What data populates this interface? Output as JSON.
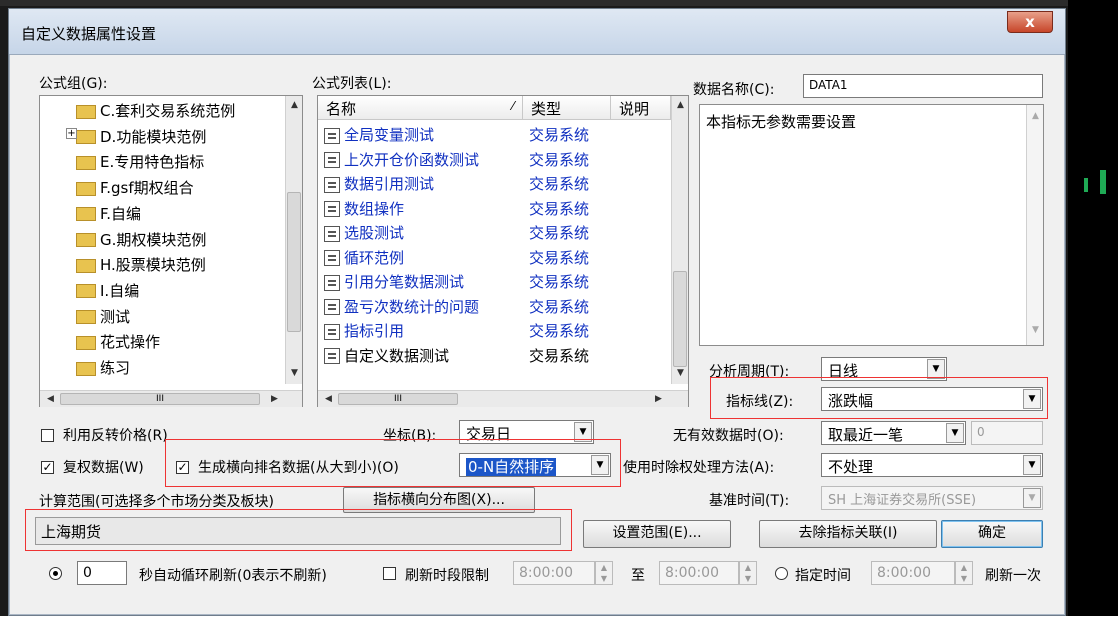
{
  "window": {
    "title": "自定义数据属性设置",
    "close_label": "x"
  },
  "formula_group": {
    "label": "公式组(G):",
    "items": [
      {
        "label": "C.套利交易系统范例",
        "expand": ""
      },
      {
        "label": "D.功能模块范例",
        "expand": "+"
      },
      {
        "label": "E.专用特色指标",
        "expand": ""
      },
      {
        "label": "F.gsf期权组合",
        "expand": ""
      },
      {
        "label": "F.自编",
        "expand": ""
      },
      {
        "label": "G.期权模块范例",
        "expand": ""
      },
      {
        "label": "H.股票模块范例",
        "expand": ""
      },
      {
        "label": "I.自编",
        "expand": ""
      },
      {
        "label": "测试",
        "expand": ""
      },
      {
        "label": "花式操作",
        "expand": ""
      },
      {
        "label": "练习",
        "expand": ""
      }
    ],
    "hscroll_grip": "III"
  },
  "formula_list": {
    "label": "公式列表(L):",
    "columns": {
      "name": "名称",
      "type": "类型",
      "desc": "说明"
    },
    "rows": [
      {
        "name": "全局变量测试",
        "type": "交易系统"
      },
      {
        "name": "上次开仓价函数测试",
        "type": "交易系统"
      },
      {
        "name": "数据引用测试",
        "type": "交易系统"
      },
      {
        "name": "数组操作",
        "type": "交易系统"
      },
      {
        "name": "选股测试",
        "type": "交易系统"
      },
      {
        "name": "循环范例",
        "type": "交易系统"
      },
      {
        "name": "引用分笔数据测试",
        "type": "交易系统"
      },
      {
        "name": "盈亏次数统计的问题",
        "type": "交易系统"
      },
      {
        "name": "指标引用",
        "type": "交易系统"
      },
      {
        "name": "自定义数据测试",
        "type": "交易系统"
      }
    ],
    "hscroll_grip": "III"
  },
  "data_name": {
    "label": "数据名称(C):",
    "value": "DATA1"
  },
  "description": "本指标无参数需要设置",
  "analysis_period": {
    "label": "分析周期(T):",
    "value": "日线"
  },
  "indicator_line": {
    "label": "指标线(Z):",
    "value": "涨跌幅"
  },
  "reverse_price": {
    "label": "利用反转价格(R)",
    "checked": false
  },
  "coordinate": {
    "label": "坐标(B):",
    "value": "交易日"
  },
  "no_valid_data": {
    "label": "无有效数据时(O):",
    "value": "取最近一笔",
    "extra": "0"
  },
  "adjusted_data": {
    "label": "复权数据(W)",
    "checked": true,
    "mark": "✓"
  },
  "ranking_data": {
    "label": "生成横向排名数据(从大到小)(O)",
    "checked": true,
    "mark": "✓",
    "value": "0-N自然排序"
  },
  "exright_method": {
    "label": "使用时除权处理方法(A):",
    "value": "不处理"
  },
  "calc_range": {
    "label": "计算范围(可选择多个市场分类及板块)",
    "value": "上海期货"
  },
  "distribution_button": "指标横向分布图(X)...",
  "base_time": {
    "label": "基准时间(T):",
    "value": "SH 上海证券交易所(SSE)"
  },
  "buttons": {
    "set_range": "设置范围(E)...",
    "remove_link": "去除指标关联(I)",
    "ok": "确定"
  },
  "refresh": {
    "seconds_value": "0",
    "auto_label": "秒自动循环刷新(0表示不刷新)",
    "period_label": "刷新时段限制",
    "start": "8:00:00",
    "to": "至",
    "end": "8:00:00",
    "fixed_label": "指定时间",
    "fixed_time": "8:00:00",
    "once_label": "刷新一次"
  }
}
